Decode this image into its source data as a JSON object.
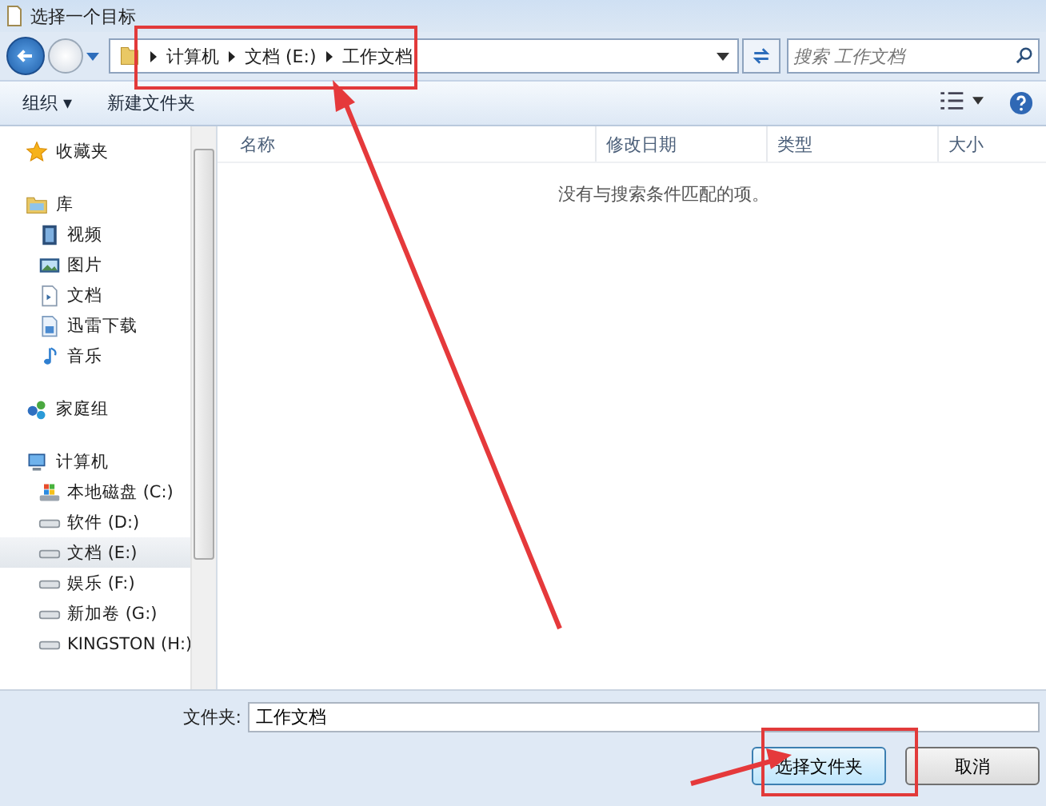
{
  "window": {
    "title": "选择一个目标"
  },
  "address": {
    "crumbs": [
      "计算机",
      "文档 (E:)",
      "工作文档"
    ]
  },
  "search": {
    "placeholder": "搜索 工作文档"
  },
  "toolbar": {
    "organize": "组织 ▾",
    "new_folder": "新建文件夹"
  },
  "sidebar": {
    "groups": [
      {
        "label": "收藏夹",
        "kind": "star",
        "selected": false
      },
      {
        "label": "库",
        "kind": "library",
        "selected": false,
        "children": [
          {
            "label": "视频",
            "kind": "video",
            "selected": false
          },
          {
            "label": "图片",
            "kind": "picture",
            "selected": false
          },
          {
            "label": "文档",
            "kind": "document",
            "selected": false
          },
          {
            "label": "迅雷下载",
            "kind": "download",
            "selected": false
          },
          {
            "label": "音乐",
            "kind": "music",
            "selected": false
          }
        ]
      },
      {
        "label": "家庭组",
        "kind": "homegroup",
        "selected": false
      },
      {
        "label": "计算机",
        "kind": "computer",
        "selected": false,
        "children": [
          {
            "label": "本地磁盘 (C:)",
            "kind": "system-drive",
            "selected": false
          },
          {
            "label": "软件 (D:)",
            "kind": "drive",
            "selected": false
          },
          {
            "label": "文档 (E:)",
            "kind": "drive",
            "selected": true
          },
          {
            "label": "娱乐 (F:)",
            "kind": "drive",
            "selected": false
          },
          {
            "label": "新加卷 (G:)",
            "kind": "drive",
            "selected": false
          },
          {
            "label": "KINGSTON (H:)",
            "kind": "drive",
            "selected": false
          }
        ]
      }
    ]
  },
  "table": {
    "columns": [
      "名称",
      "修改日期",
      "类型",
      "大小"
    ],
    "empty_message": "没有与搜索条件匹配的项。"
  },
  "folder_field": {
    "label": "文件夹:",
    "value": "工作文档"
  },
  "buttons": [
    "选择文件夹",
    "取消"
  ]
}
